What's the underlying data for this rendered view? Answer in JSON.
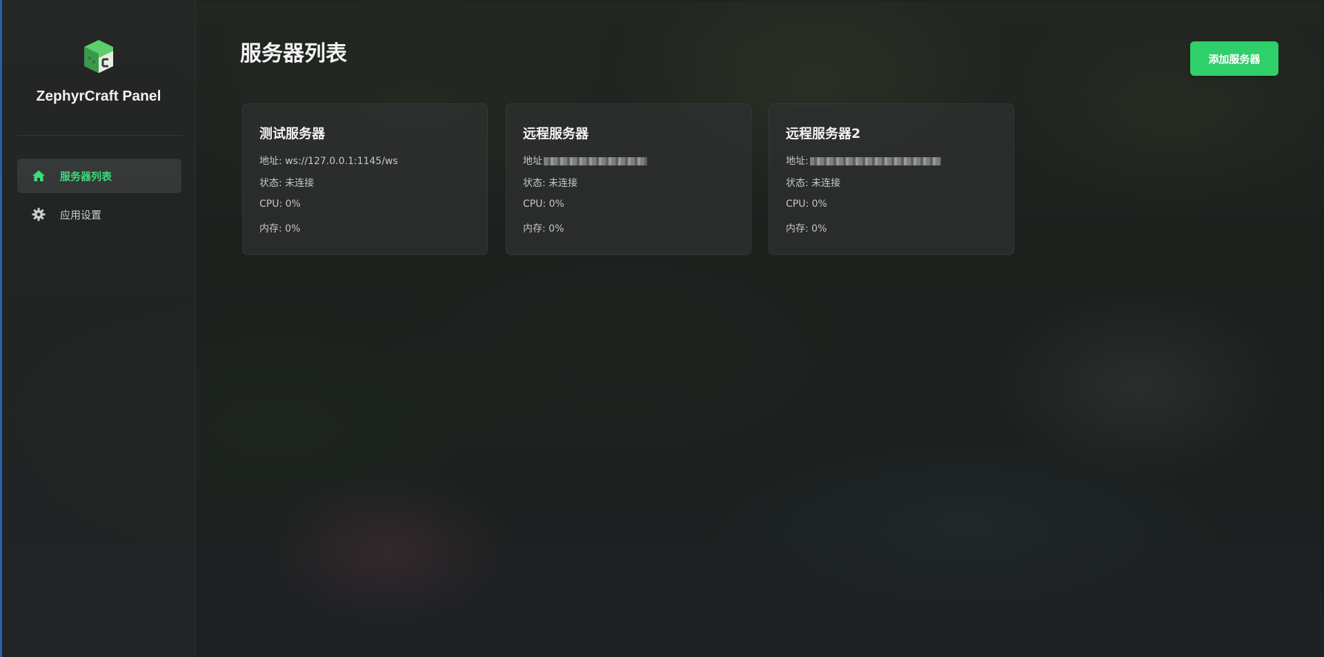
{
  "sidebar": {
    "brand": "ZephyrCraft Panel",
    "logo_icon": "grass-block-logo-icon",
    "items": [
      {
        "label": "服务器列表",
        "icon": "home-icon",
        "active": true
      },
      {
        "label": "应用设置",
        "icon": "gear-icon",
        "active": false
      }
    ]
  },
  "main": {
    "title": "服务器列表",
    "add_button_label": "添加服务器",
    "servers": [
      {
        "name": "测试服务器",
        "address": "地址: ws://127.0.0.1:1145/ws",
        "status": "状态: 未连接",
        "cpu": "CPU: 0%",
        "memory": "内存: 0%"
      },
      {
        "name": "远程服务器",
        "address": "地址",
        "status": "状态: 未连接",
        "cpu": "CPU: 0%",
        "memory": "内存: 0%"
      },
      {
        "name": "远程服务器2",
        "address": "地址:",
        "status": "状态: 未连接",
        "cpu": "CPU: 0%",
        "memory": "内存: 0%"
      }
    ]
  },
  "colors": {
    "accent": "#2fcf6a",
    "active_nav_text": "#3ddc7a",
    "window_edge": "#2a5fb0"
  }
}
